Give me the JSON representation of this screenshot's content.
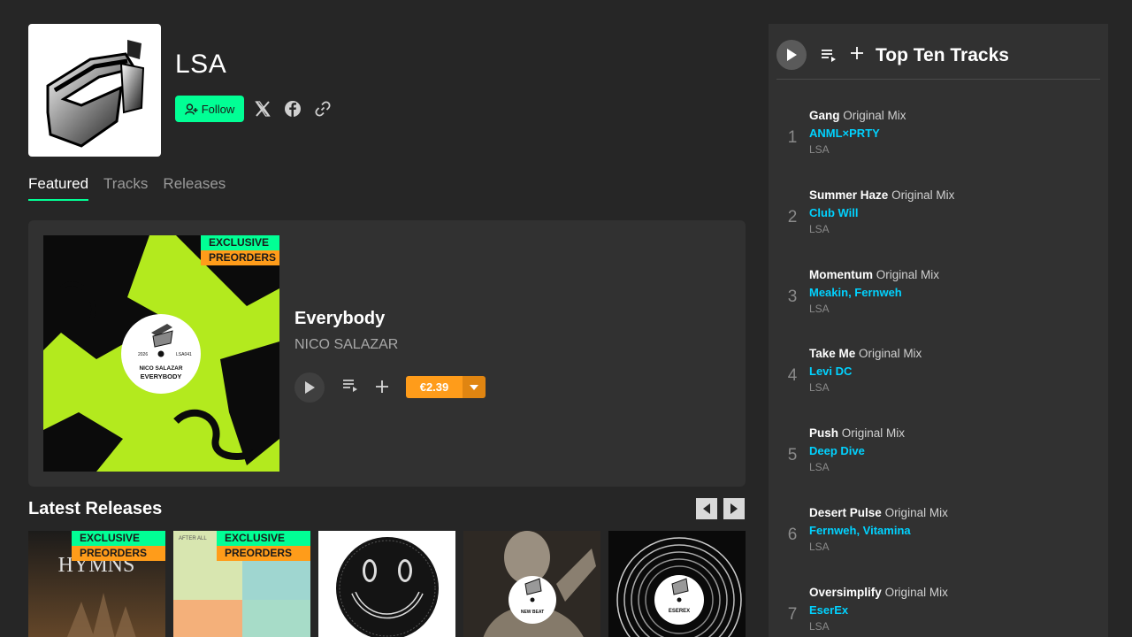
{
  "label": {
    "name": "LSA",
    "follow_label": "Follow"
  },
  "tabs": [
    "Featured",
    "Tracks",
    "Releases"
  ],
  "featured": {
    "badge_exclusive": "EXCLUSIVE",
    "badge_preorders": "PREORDERS",
    "title": "Everybody",
    "artist": "NICO SALAZAR",
    "price": "€2.39",
    "art_text": {
      "year": "2026",
      "catalog": "LSA041",
      "artist": "NICO SALAZAR",
      "title": "EVERYBODY"
    }
  },
  "latest": {
    "title": "Latest Releases",
    "releases": [
      {
        "badge_exclusive": "EXCLUSIVE",
        "badge_preorders": "PREORDERS",
        "art_text": "HYMNS"
      },
      {
        "badge_exclusive": "EXCLUSIVE",
        "badge_preorders": "PREORDERS",
        "art_text": "AFTER ALL"
      },
      {
        "art_text": ""
      },
      {
        "art_text": "NEW BEAT"
      },
      {
        "art_text": "ESEREX"
      }
    ]
  },
  "top_tracks": {
    "title": "Top Ten Tracks",
    "tracks": [
      {
        "num": "1",
        "title": "Gang",
        "mix": "Original Mix",
        "artist": "ANML×PRTY",
        "label": "LSA"
      },
      {
        "num": "2",
        "title": "Summer Haze",
        "mix": "Original Mix",
        "artist": "Club Will",
        "label": "LSA"
      },
      {
        "num": "3",
        "title": "Momentum",
        "mix": "Original Mix",
        "artist": "Meakin, Fernweh",
        "label": "LSA"
      },
      {
        "num": "4",
        "title": "Take Me",
        "mix": "Original Mix",
        "artist": "Levi DC",
        "label": "LSA"
      },
      {
        "num": "5",
        "title": "Push",
        "mix": "Original Mix",
        "artist": "Deep Dive",
        "label": "LSA"
      },
      {
        "num": "6",
        "title": "Desert Pulse",
        "mix": "Original Mix",
        "artist": "Fernweh, Vitamina",
        "label": "LSA"
      },
      {
        "num": "7",
        "title": "Oversimplify",
        "mix": "Original Mix",
        "artist": "EserEx",
        "label": "LSA"
      }
    ]
  },
  "colors": {
    "accent": "#01ff95",
    "price": "#ff9c1a",
    "artist_link": "#01d2ff",
    "background": "#262626",
    "panel": "#313131"
  }
}
